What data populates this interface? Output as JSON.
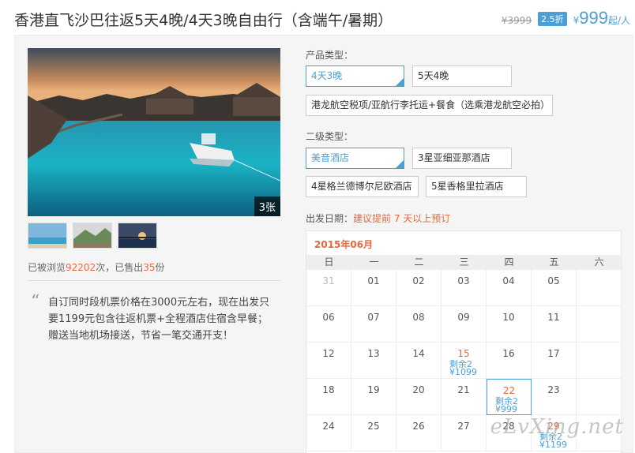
{
  "header": {
    "title": "香港直飞沙巴往返5天4晚/4天3晚自由行（含端午/暑期）",
    "old_price": "¥3999",
    "discount": "2.5折",
    "price_symbol": "¥",
    "price_value": "999",
    "price_suffix": "起/人"
  },
  "gallery": {
    "photo_count": "3张"
  },
  "stats": {
    "prefix": "已被浏览",
    "views": "92202",
    "mid": "次，已售出",
    "sold": "35",
    "suffix": "份"
  },
  "description": "自订同时段机票价格在3000元左右，现在出发只要1199元包含往返机票+全程酒店住宿含早餐；赠送当地机场接送，节省一笔交通开支！",
  "product_type": {
    "label": "产品类型：",
    "options": [
      "4天3晚",
      "5天4晚",
      "港龙航空税项/亚航行李托运+餐食（选乘港龙航空必拍）"
    ]
  },
  "secondary_type": {
    "label": "二级类型：",
    "options": [
      "美音酒店",
      "3星亚细亚那酒店",
      "4星格兰德博尔尼欧酒店",
      "5星香格里拉酒店"
    ]
  },
  "departure": {
    "label": "出发日期：",
    "note": "建议提前 7 天以上预订"
  },
  "calendar": {
    "month": "2015年06月",
    "weekdays": [
      "日",
      "一",
      "二",
      "三",
      "四",
      "五",
      "六"
    ],
    "rows": [
      [
        "31",
        "01",
        "02",
        "03",
        "04",
        "05",
        ""
      ],
      [
        "06",
        "07",
        "08",
        "09",
        "10",
        "11",
        ""
      ],
      [
        "12",
        "13",
        "14",
        "15",
        "16",
        "17",
        ""
      ],
      [
        "18",
        "19",
        "20",
        "21",
        "22",
        "23",
        ""
      ],
      [
        "24",
        "25",
        "26",
        "27",
        "28",
        "29",
        ""
      ]
    ],
    "slots": {
      "d15": {
        "remain": "剩余2",
        "price": "¥1099"
      },
      "d22": {
        "remain": "剩余2",
        "price": "¥999"
      },
      "d29": {
        "remain": "剩余2",
        "price": "¥1199"
      }
    }
  },
  "watermark": "eLvXing.net",
  "colors": {
    "accent": "#4a9fd5",
    "highlight": "#e8663c"
  },
  "icons": [
    "check-icon",
    "quote-icon"
  ]
}
